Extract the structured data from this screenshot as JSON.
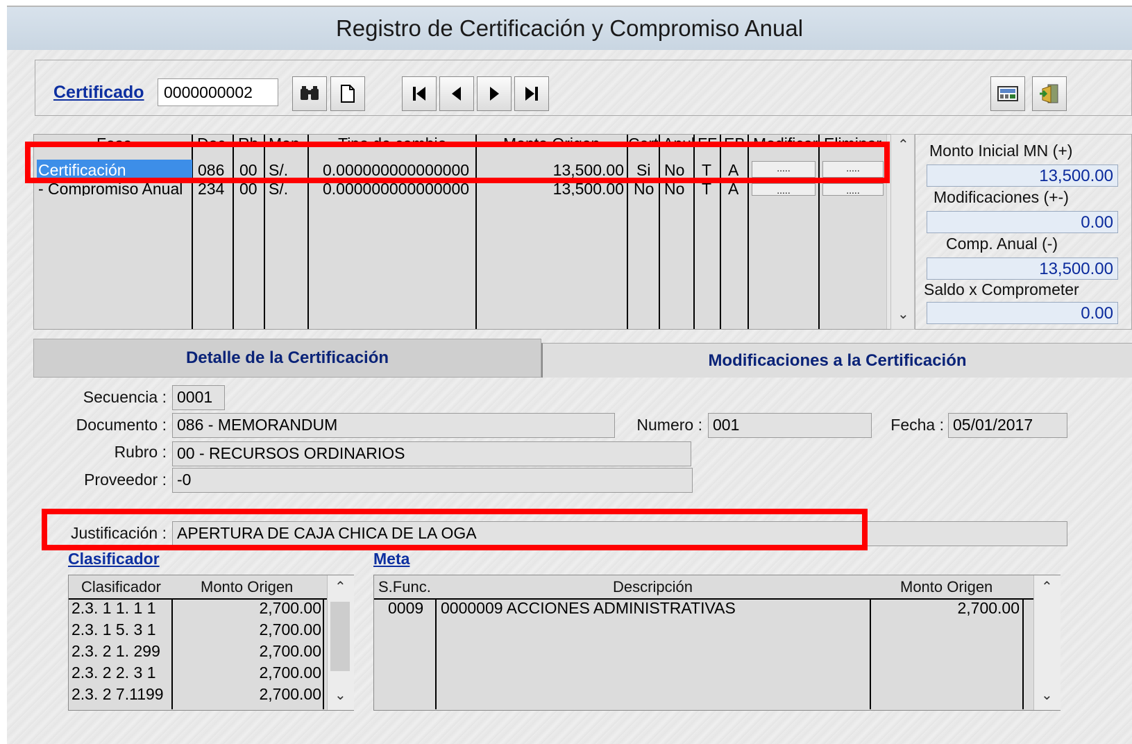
{
  "window": {
    "title": "Registro de Certificación y Compromiso Anual"
  },
  "toolbar": {
    "cert_label": "Certificado",
    "cert_value": "0000000002",
    "find_icon": "binoculars-icon",
    "new_icon": "new-document-icon",
    "nav_icons": [
      "first-record-icon",
      "previous-record-icon",
      "next-record-icon",
      "last-record-icon"
    ],
    "right_icons": [
      "calculator-report-icon",
      "exit-door-icon"
    ]
  },
  "phases": {
    "columns": [
      "Fase",
      "Doc",
      "Rb",
      "Mon",
      "Tipo de cambio",
      "Monto Origen",
      "Cert",
      "Anul",
      "FF",
      "EB",
      "Modificar",
      "Eliminar"
    ],
    "rows": [
      {
        "fase": "Certificación",
        "doc": "086",
        "rb": "00",
        "mon": "S/.",
        "tipo": "0.000000000000000",
        "monto": "13,500.00",
        "cert": "Si",
        "anul": "No",
        "ff": "T",
        "eb": "A",
        "mod": ".....",
        "elim": "....."
      },
      {
        "fase": "- Compromiso Anual",
        "doc": "234",
        "rb": "00",
        "mon": "S/.",
        "tipo": "0.000000000000000",
        "monto": "13,500.00",
        "cert": "No",
        "anul": "No",
        "ff": "T",
        "eb": "A",
        "mod": ".....",
        "elim": "....."
      }
    ]
  },
  "summary": {
    "monto_inicial_label": "Monto Inicial MN (+)",
    "monto_inicial": "13,500.00",
    "modificaciones_label": "Modificaciones (+-)",
    "modificaciones": "0.00",
    "comp_anual_label": "Comp. Anual (-)",
    "comp_anual": "13,500.00",
    "saldo_label": "Saldo x Comprometer",
    "saldo": "0.00"
  },
  "tabs": {
    "detalle": "Detalle de la Certificación",
    "modificaciones": "Modificaciones a la Certificación"
  },
  "detail": {
    "secuencia_label": "Secuencia :",
    "secuencia": "0001",
    "documento_label": "Documento :",
    "documento": "086 - MEMORANDUM",
    "numero_label": "Numero :",
    "numero": "001",
    "fecha_label": "Fecha :",
    "fecha": "05/01/2017",
    "rubro_label": "Rubro :",
    "rubro": "00 - RECURSOS ORDINARIOS",
    "proveedor_label": "Proveedor :",
    "proveedor": "-0",
    "justificacion_label": "Justificación :",
    "justificacion": "APERTURA DE CAJA CHICA DE LA OGA"
  },
  "clasificador": {
    "title": "Clasificador",
    "columns": [
      "Clasificador",
      "Monto Origen"
    ],
    "rows": [
      {
        "code": "2.3. 1 1. 1 1",
        "monto": "2,700.00"
      },
      {
        "code": "2.3. 1 5. 3 1",
        "monto": "2,700.00"
      },
      {
        "code": "2.3. 2 1. 299",
        "monto": "2,700.00"
      },
      {
        "code": "2.3. 2 2. 3 1",
        "monto": "2,700.00"
      },
      {
        "code": "2.3. 2 7.1199",
        "monto": "2,700.00"
      }
    ]
  },
  "meta": {
    "title": "Meta",
    "columns": [
      "S.Func.",
      "Descripción",
      "Monto Origen"
    ],
    "rows": [
      {
        "sfunc": "0009",
        "desc": "0000009  ACCIONES ADMINISTRATIVAS",
        "monto": "2,700.00"
      }
    ]
  },
  "colors": {
    "highlight": "#ff0000",
    "selected_row": "#3d8ee8",
    "link": "#0d2fa0"
  }
}
